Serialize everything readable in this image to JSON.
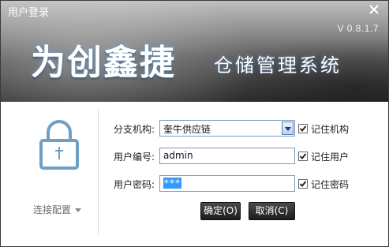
{
  "window": {
    "title": "用户登录",
    "version": "V 0.8.1.7",
    "close_icon": "close-icon"
  },
  "brand": {
    "name": "为创鑫捷",
    "subtitle": "仓储管理系统"
  },
  "left_panel": {
    "lock_icon": "lock-icon",
    "config_label": "连接配置",
    "config_icon": "caret-down-icon"
  },
  "form": {
    "branch": {
      "label": "分支机构:",
      "value": "奎牛供应链",
      "remember_label": "记住机构",
      "remember_checked": true
    },
    "user": {
      "label": "用户编号:",
      "value": "admin",
      "remember_label": "记住用户",
      "remember_checked": true
    },
    "password": {
      "label": "用户密码:",
      "value": "***",
      "remember_label": "记住密码",
      "remember_checked": true
    }
  },
  "buttons": {
    "ok": "确定(O)",
    "cancel": "取消(C)"
  },
  "colors": {
    "accent_blue": "#3399ff",
    "lock_blue": "#6e9fc4",
    "button_dark": "#1c1c1c"
  }
}
